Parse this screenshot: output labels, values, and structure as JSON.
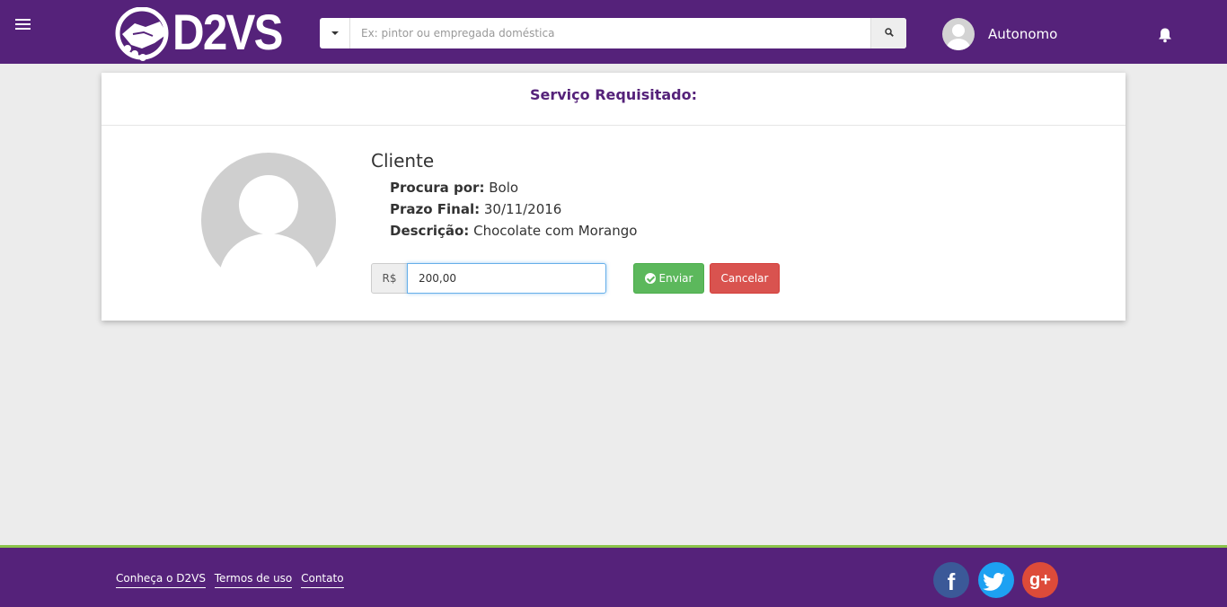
{
  "header": {
    "logo_text": "D2VS",
    "search_placeholder": "Ex: pintor ou empregada doméstica",
    "user_name": "Autonomo"
  },
  "card": {
    "title": "Serviço Requisitado:",
    "client_name": "Cliente",
    "fields": [
      {
        "label": "Procura por:",
        "value": "Bolo"
      },
      {
        "label": "Prazo Final:",
        "value": "30/11/2016"
      },
      {
        "label": "Descrição:",
        "value": "Chocolate com Morango"
      }
    ],
    "currency": "R$",
    "price_value": "200,00",
    "send_label": "Enviar",
    "cancel_label": "Cancelar"
  },
  "footer": {
    "links": [
      "Conheça o D2VS",
      "Termos de uso",
      "Contato"
    ],
    "social": [
      {
        "icon": "facebook-icon",
        "glyph": "f"
      },
      {
        "icon": "twitter-icon",
        "glyph": ""
      },
      {
        "icon": "google-plus-icon",
        "glyph": "g+"
      }
    ]
  },
  "colors": {
    "brand": "#55227a",
    "footer_accent": "#8bc34a",
    "success": "#5cb85c",
    "danger": "#d9534f"
  }
}
